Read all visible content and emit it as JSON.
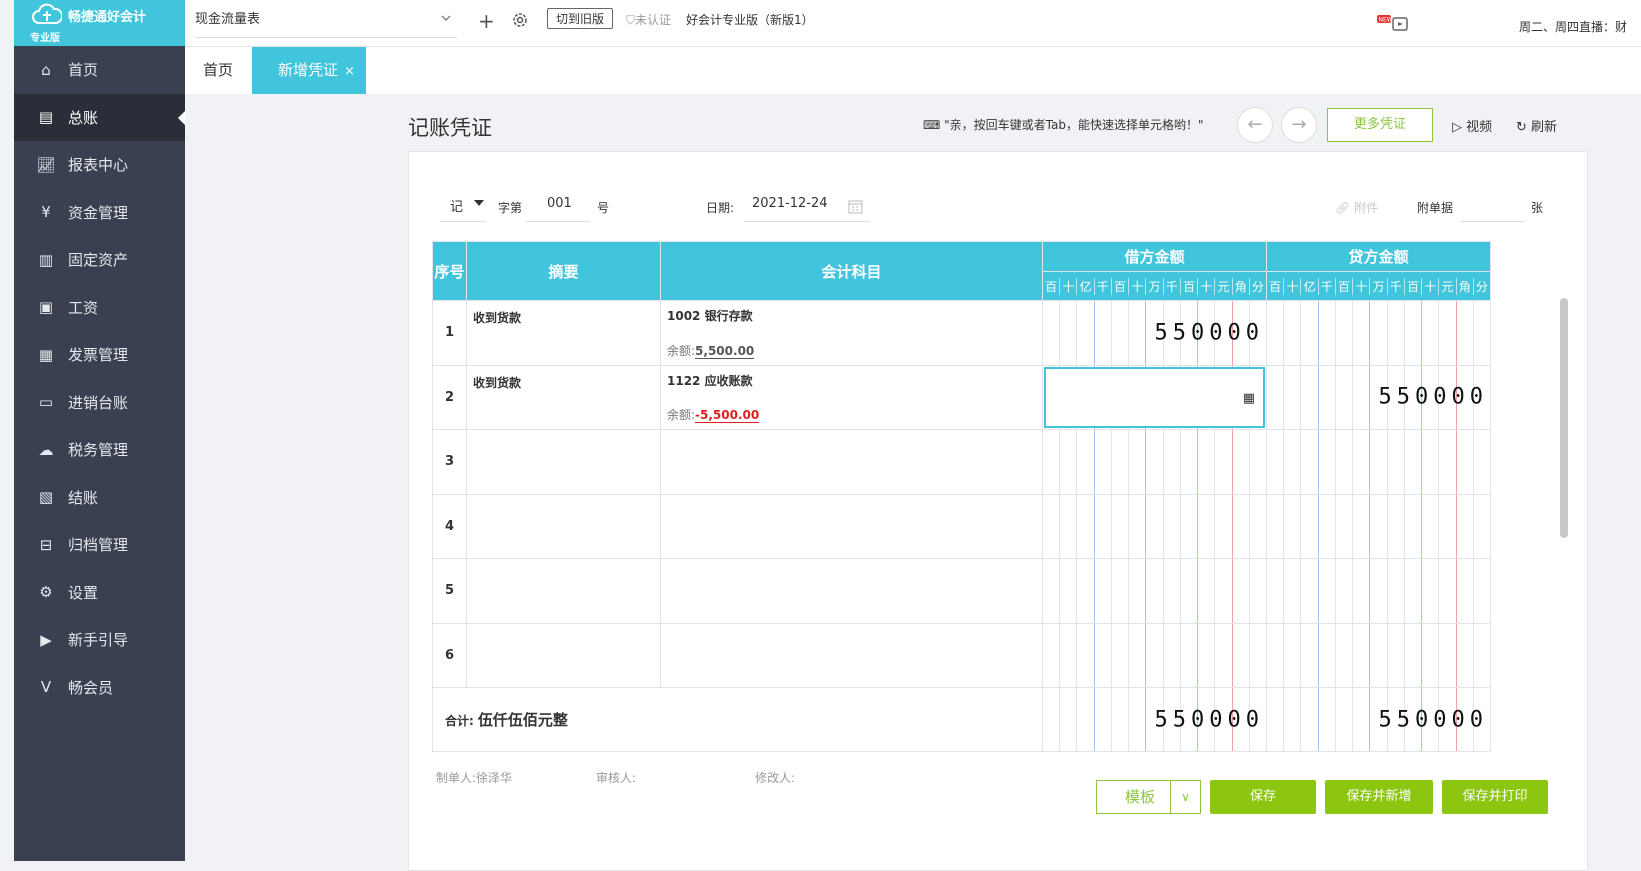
{
  "app": {
    "name": "畅捷通好会计",
    "edition": "专业版"
  },
  "sidebar": {
    "items": [
      {
        "label": "首页",
        "icon": "home-icon"
      },
      {
        "label": "总账",
        "icon": "ledger-icon",
        "active": true
      },
      {
        "label": "报表中心",
        "icon": "chart-icon"
      },
      {
        "label": "资金管理",
        "icon": "money-bag-icon"
      },
      {
        "label": "固定资产",
        "icon": "building-icon"
      },
      {
        "label": "工资",
        "icon": "salary-icon"
      },
      {
        "label": "发票管理",
        "icon": "invoice-icon"
      },
      {
        "label": "进销台账",
        "icon": "inventory-icon"
      },
      {
        "label": "税务管理",
        "icon": "tax-icon"
      },
      {
        "label": "结账",
        "icon": "checkout-icon"
      },
      {
        "label": "归档管理",
        "icon": "archive-icon"
      },
      {
        "label": "设置",
        "icon": "gear-icon"
      },
      {
        "label": "新手引导",
        "icon": "guide-icon"
      },
      {
        "label": "畅会员",
        "icon": "vip-icon"
      }
    ]
  },
  "topbar": {
    "report_select": "现金流量表",
    "switch_label": "切到旧版",
    "unverified": "未认证",
    "company": "好会计专业版（新版1）",
    "live_notice": "周二、周四直播：财",
    "new_badge": "NEW"
  },
  "tabs": {
    "home": "首页",
    "active": "新增凭证",
    "close": "×"
  },
  "voucher": {
    "title": "记账凭证",
    "tip": "\"亲，按回车键或者Tab，能快速选择单元格哟！\"",
    "more_label": "更多凭证",
    "video_label": "视频",
    "refresh_label": "刷新",
    "type": "记",
    "type_suffix": "字第",
    "number": "001",
    "number_suffix": "号",
    "date_label": "日期:",
    "date": "2021-12-24",
    "attachment_label": "附件",
    "attach_docs_label": "附单据",
    "attach_unit": "张",
    "columns": {
      "seq": "序号",
      "summary": "摘要",
      "subject": "会计科目",
      "debit": "借方金额",
      "credit": "贷方金额"
    },
    "digit_headers": [
      "百",
      "十",
      "亿",
      "千",
      "百",
      "十",
      "万",
      "千",
      "百",
      "十",
      "元",
      "角",
      "分"
    ],
    "rows": [
      {
        "no": "1",
        "summary": "收到货款",
        "subject": "1002 银行存款",
        "balance_label": "余额:",
        "balance": "5,500.00",
        "debit": "550000",
        "credit": ""
      },
      {
        "no": "2",
        "summary": "收到货款",
        "subject": "1122 应收账款",
        "balance_label": "余额:",
        "balance": "-5,500.00",
        "debit": "",
        "credit": "550000"
      },
      {
        "no": "3",
        "summary": "",
        "subject": "",
        "debit": "",
        "credit": ""
      },
      {
        "no": "4",
        "summary": "",
        "subject": "",
        "debit": "",
        "credit": ""
      },
      {
        "no": "5",
        "summary": "",
        "subject": "",
        "debit": "",
        "credit": ""
      },
      {
        "no": "6",
        "summary": "",
        "subject": "",
        "debit": "",
        "credit": ""
      }
    ],
    "total_label": "合计:",
    "total_words": "伍仟伍佰元整",
    "total_debit": "550000",
    "total_credit": "550000",
    "maker_label": "制单人:",
    "maker": "徐泽华",
    "reviewer_label": "审核人:",
    "modifier_label": "修改人:",
    "buttons": {
      "template": "模板",
      "save": "保存",
      "save_new": "保存并新增",
      "save_print": "保存并打印"
    }
  },
  "colors": {
    "accent": "#40c5dc",
    "sidebar": "#3a4050",
    "green": "#8cc611",
    "negative": "#e02020"
  }
}
